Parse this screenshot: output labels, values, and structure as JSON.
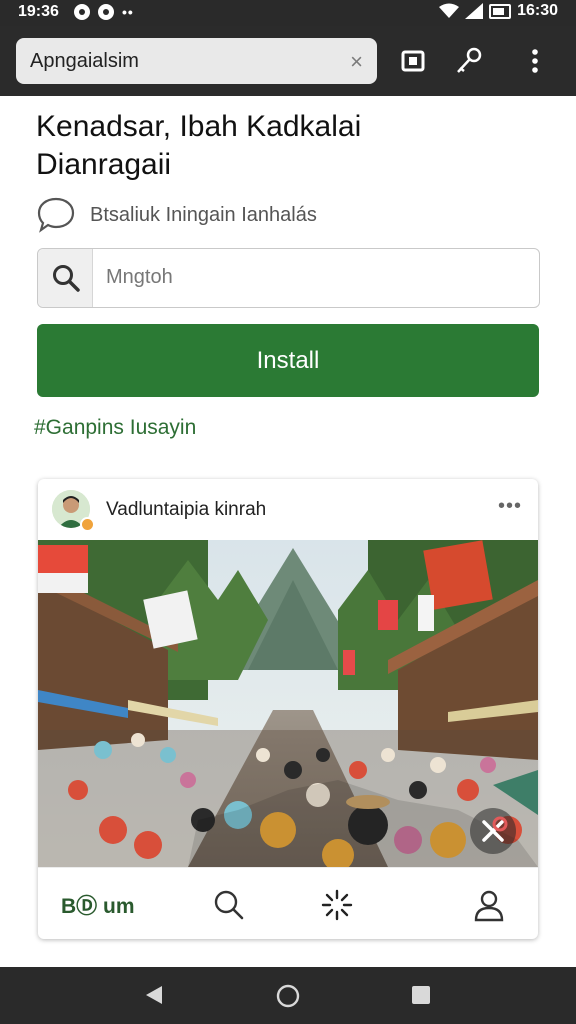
{
  "status_bar": {
    "time": "19:36",
    "right_time": "16:30"
  },
  "browser": {
    "url": "Apngaialsim",
    "clear_symbol": "×"
  },
  "page": {
    "title_line1": "Kenadsar, Ibah Kadkalai",
    "title_line2": "Dianragaii",
    "comment_text": "Btsaliuk Iningain Ianhalás",
    "search": {
      "value": "Mngtoh"
    },
    "install_label": "Install",
    "hashtag": "#Ganpins Iusayin"
  },
  "card": {
    "author": "Vadluntaipia kinrah",
    "more_symbol": "•••",
    "nav_home_label": "BⒹ um"
  },
  "colors": {
    "install": "#2b7a34",
    "hashtag": "#2d6e34",
    "bars": "#2a2a2a"
  }
}
